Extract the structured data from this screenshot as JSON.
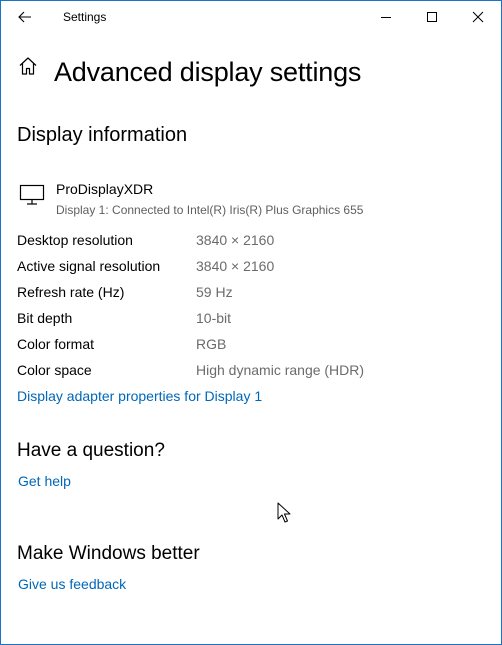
{
  "window": {
    "app_title": "Settings"
  },
  "header": {
    "page_title": "Advanced display settings"
  },
  "display_information": {
    "section_title": "Display information",
    "display_name": "ProDisplayXDR",
    "display_description": "Display 1: Connected to Intel(R) Iris(R) Plus Graphics 655",
    "rows": [
      {
        "label": "Desktop resolution",
        "value": "3840 × 2160"
      },
      {
        "label": "Active signal resolution",
        "value": "3840 × 2160"
      },
      {
        "label": "Refresh rate (Hz)",
        "value": "59 Hz"
      },
      {
        "label": "Bit depth",
        "value": "10-bit"
      },
      {
        "label": "Color format",
        "value": "RGB"
      },
      {
        "label": "Color space",
        "value": "High dynamic range (HDR)"
      }
    ],
    "adapter_link": "Display adapter properties for Display 1"
  },
  "question": {
    "section_title": "Have a question?",
    "link": "Get help"
  },
  "better": {
    "section_title": "Make Windows better",
    "link": "Give us feedback"
  },
  "icons": {
    "back": "back-arrow-icon",
    "minimize": "minimize-icon",
    "maximize": "maximize-icon",
    "close": "close-icon",
    "home": "home-icon",
    "monitor": "monitor-icon",
    "cursor": "mouse-cursor-icon"
  },
  "colors": {
    "link": "#0067b8",
    "window_border": "#1a73c8",
    "value_text": "#6b6b6b"
  }
}
